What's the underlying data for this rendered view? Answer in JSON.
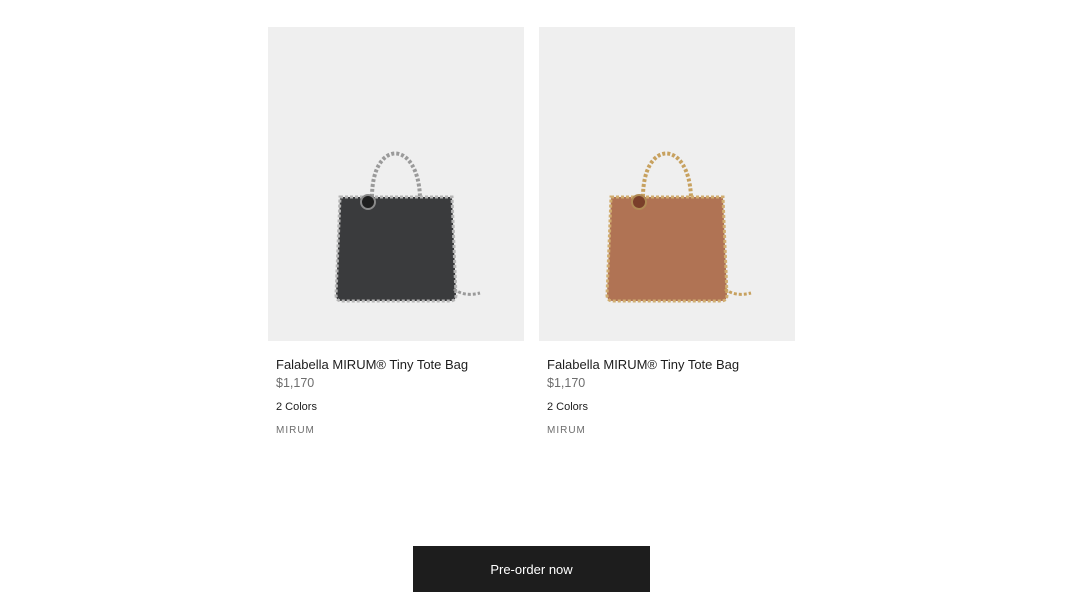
{
  "products": [
    {
      "name": "Falabella MIRUM® Tiny Tote Bag",
      "price": "$1,170",
      "colors": "2 Colors",
      "material": "MIRUM",
      "image": "black-chain-tote-bag",
      "bag_color": "#3a3b3d",
      "chain_color": "#a9a9a9"
    },
    {
      "name": "Falabella MIRUM® Tiny Tote Bag",
      "price": "$1,170",
      "colors": "2 Colors",
      "material": "MIRUM",
      "image": "tan-chain-tote-bag",
      "bag_color": "#b07354",
      "chain_color": "#c9a56a"
    }
  ],
  "cta": {
    "label": "Pre-order now"
  }
}
